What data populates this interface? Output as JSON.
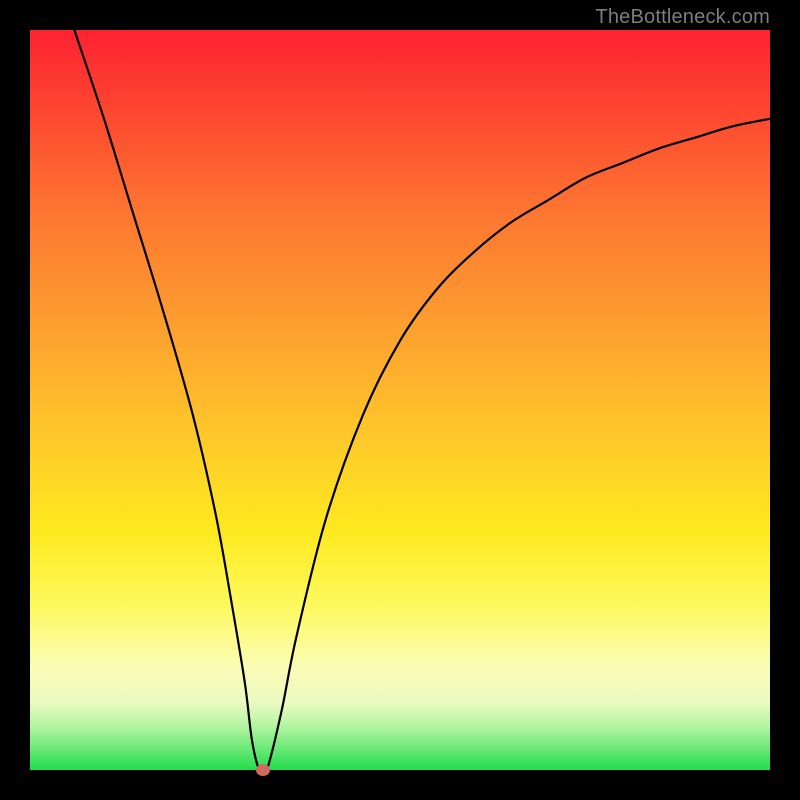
{
  "watermark": "TheBottleneck.com",
  "colors": {
    "frame": "#000000",
    "curve": "#000000",
    "marker": "#ce6a5e",
    "gradient_top": "#fd2332",
    "gradient_bottom": "#1fdd4e"
  },
  "chart_data": {
    "type": "line",
    "title": "",
    "xlabel": "",
    "ylabel": "",
    "xlim": [
      0,
      100
    ],
    "ylim": [
      0,
      100
    ],
    "grid": false,
    "series": [
      {
        "name": "bottleneck-curve",
        "x": [
          6,
          10,
          14,
          18,
          22,
          25,
          27,
          29,
          30,
          31,
          32,
          34,
          36,
          40,
          45,
          50,
          55,
          60,
          65,
          70,
          75,
          80,
          85,
          90,
          95,
          100
        ],
        "y": [
          100,
          88,
          75,
          62,
          48,
          35,
          24,
          12,
          4,
          0,
          0,
          8,
          18,
          34,
          48,
          58,
          65,
          70,
          74,
          77,
          80,
          82,
          84,
          85.5,
          87,
          88
        ]
      }
    ],
    "marker": {
      "x": 31.5,
      "y": 0
    },
    "notes": "y-axis inverted visually: 0 at bottom (green), 100 at top (red). Curve is a V shape with minimum near x≈31 then rising with diminishing slope."
  }
}
